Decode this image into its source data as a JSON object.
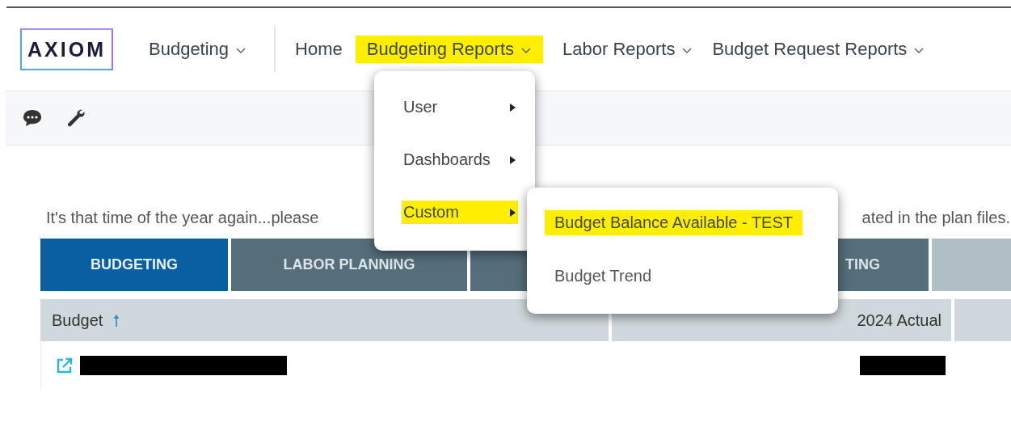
{
  "nav": {
    "logo": "AXIOM",
    "items": [
      {
        "label": "Budgeting",
        "dropdown": true,
        "highlighted": false,
        "separator_after": true
      },
      {
        "label": "Home",
        "dropdown": false,
        "highlighted": false,
        "separator_after": false
      },
      {
        "label": "Budgeting Reports",
        "dropdown": true,
        "highlighted": true,
        "separator_after": false
      },
      {
        "label": "Labor Reports",
        "dropdown": true,
        "highlighted": false,
        "separator_after": false
      },
      {
        "label": "Budget Request Reports",
        "dropdown": true,
        "highlighted": false,
        "separator_after": false
      }
    ]
  },
  "message": {
    "visible_start": "It's that time of the year again...please",
    "visible_end": "ated in the plan files."
  },
  "tabs": [
    {
      "label": "BUDGETING",
      "selected": true,
      "kind": "normal"
    },
    {
      "label": "LABOR PLANNING",
      "selected": false,
      "kind": "normal"
    },
    {
      "selected": false,
      "kind": "normal"
    },
    {
      "label": "TING",
      "selected": false,
      "kind": "normal"
    },
    {
      "selected": false,
      "kind": "muted"
    }
  ],
  "table": {
    "columns": [
      {
        "label": "Budget",
        "sort_ascending": true
      },
      {
        "label": "2024 Actual"
      },
      {}
    ]
  },
  "menu": {
    "items": [
      {
        "label": "User",
        "submenu": true,
        "highlighted": false
      },
      {
        "label": "Dashboards",
        "submenu": true,
        "highlighted": false
      },
      {
        "label": "Custom",
        "submenu": true,
        "highlighted": true
      }
    ]
  },
  "submenu": {
    "items": [
      {
        "label": "Budget Balance Available - TEST",
        "highlighted": true
      },
      {
        "label": "Budget Trend",
        "highlighted": false
      }
    ]
  }
}
